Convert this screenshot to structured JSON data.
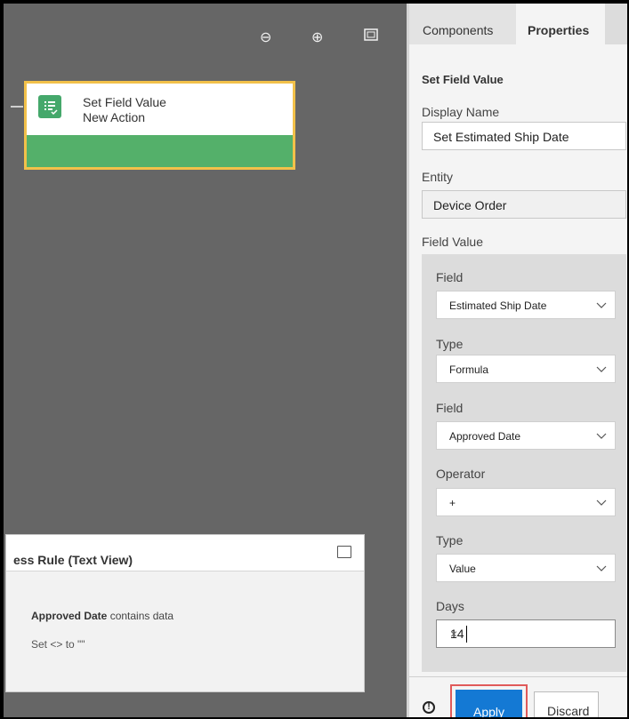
{
  "canvas": {
    "tools": {
      "zoom_out": "⊖",
      "zoom_in": "⊕",
      "fit": "⛶"
    },
    "action_card": {
      "title": "Set Field Value",
      "subtitle": "New Action"
    },
    "rule_panel": {
      "title": "ess Rule (Text View)",
      "condition_field": "Approved Date",
      "condition_text": " contains data",
      "action_text": "Set <> to \"\""
    }
  },
  "panel": {
    "tabs": [
      {
        "label": "Components"
      },
      {
        "label": "Properties"
      }
    ],
    "section_title": "Set Field Value",
    "display_name": {
      "label": "Display Name",
      "value": "Set Estimated Ship Date"
    },
    "entity": {
      "label": "Entity",
      "value": "Device Order"
    },
    "field_value": {
      "label": "Field Value",
      "rows": [
        {
          "label": "Field",
          "value": "Estimated Ship Date"
        },
        {
          "label": "Type",
          "value": "Formula"
        },
        {
          "label": "Field",
          "value": "Approved Date"
        },
        {
          "label": "Operator",
          "value": "+"
        },
        {
          "label": "Type",
          "value": "Value"
        }
      ],
      "days": {
        "label": "Days",
        "value": "14",
        "clear": "×"
      }
    },
    "footer": {
      "info": "!",
      "apply": "Apply",
      "discard": "Discard"
    }
  }
}
